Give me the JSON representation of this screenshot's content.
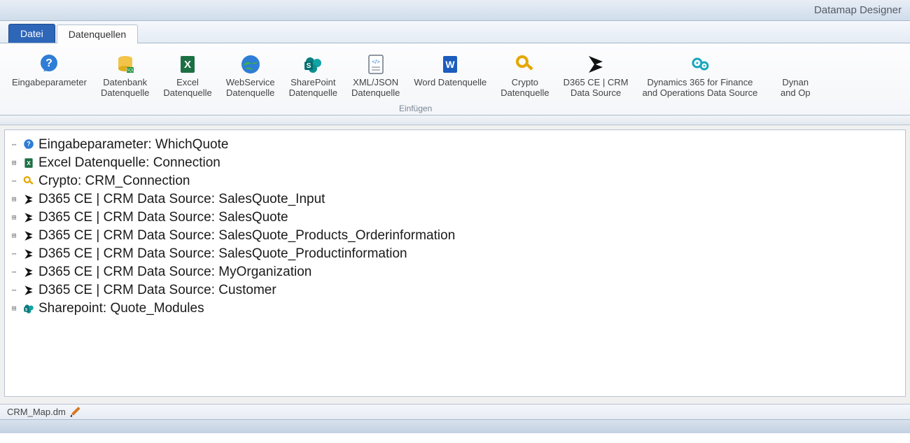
{
  "app": {
    "title": "Datamap Designer"
  },
  "tabs": {
    "file": "Datei",
    "datasources": "Datenquellen"
  },
  "ribbon": {
    "group_caption": "Einfügen",
    "buttons": [
      {
        "id": "input-params",
        "line1": "Eingabeparameter",
        "line2": "",
        "icon": "bubble-question-icon"
      },
      {
        "id": "db-source",
        "line1": "Datenbank",
        "line2": "Datenquelle",
        "icon": "database-icon"
      },
      {
        "id": "excel-source",
        "line1": "Excel",
        "line2": "Datenquelle",
        "icon": "excel-icon"
      },
      {
        "id": "webservice-source",
        "line1": "WebService",
        "line2": "Datenquelle",
        "icon": "globe-icon"
      },
      {
        "id": "sharepoint-source",
        "line1": "SharePoint",
        "line2": "Datenquelle",
        "icon": "sharepoint-icon"
      },
      {
        "id": "xmljson-source",
        "line1": "XML/JSON",
        "line2": "Datenquelle",
        "icon": "xml-file-icon"
      },
      {
        "id": "word-source",
        "line1": "Word Datenquelle",
        "line2": "",
        "icon": "word-icon"
      },
      {
        "id": "crypto-source",
        "line1": "Crypto",
        "line2": "Datenquelle",
        "icon": "key-icon"
      },
      {
        "id": "d365ce-source",
        "line1": "D365 CE | CRM",
        "line2": "Data Source",
        "icon": "dynamics-ce-icon"
      },
      {
        "id": "d365fo-source",
        "line1": "Dynamics 365 for Finance",
        "line2": "and Operations Data Source",
        "icon": "gears-icon"
      },
      {
        "id": "d365bc-source",
        "line1": "Dynan",
        "line2": "and Op",
        "icon": ""
      }
    ]
  },
  "tree": [
    {
      "expander": "bullet",
      "icon": "bubble-question-icon-sm",
      "label": "Eingabeparameter: WhichQuote"
    },
    {
      "expander": "plus",
      "icon": "excel-icon-sm",
      "label": "Excel Datenquelle: Connection"
    },
    {
      "expander": "bullet",
      "icon": "key-icon-sm",
      "label": "Crypto: CRM_Connection"
    },
    {
      "expander": "plus",
      "icon": "dynamics-ce-icon-sm",
      "label": "D365 CE | CRM Data Source: SalesQuote_Input"
    },
    {
      "expander": "plus",
      "icon": "dynamics-ce-icon-sm",
      "label": "D365 CE | CRM Data Source: SalesQuote"
    },
    {
      "expander": "plus",
      "icon": "dynamics-ce-icon-sm",
      "label": "D365 CE | CRM Data Source: SalesQuote_Products_Orderinformation"
    },
    {
      "expander": "bullet",
      "icon": "dynamics-ce-icon-sm",
      "label": "D365 CE | CRM Data Source: SalesQuote_Productinformation"
    },
    {
      "expander": "bullet",
      "icon": "dynamics-ce-icon-sm",
      "label": "D365 CE | CRM Data Source: MyOrganization"
    },
    {
      "expander": "bullet",
      "icon": "dynamics-ce-icon-sm",
      "label": "D365 CE | CRM Data Source: Customer"
    },
    {
      "expander": "plus",
      "icon": "sharepoint-icon-sm",
      "label": "Sharepoint: Quote_Modules"
    }
  ],
  "status": {
    "filename": "CRM_Map.dm"
  }
}
